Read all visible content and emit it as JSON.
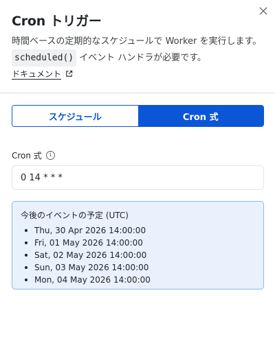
{
  "panel": {
    "title": "Cron トリガー",
    "description_line1": "時間ベースの定期的なスケジュールで Worker を実行します。",
    "code_snippet": "scheduled()",
    "description_line2_suffix": "イベント ハンドラが必要です。",
    "doc_link_label": "ドキュメント",
    "close_icon": "close-icon",
    "external_link_icon": "external-link-icon"
  },
  "mode_toggle": {
    "options": [
      "スケジュール",
      "Cron 式"
    ],
    "selected": "Cron 式",
    "accent_color": "#0a56d6"
  },
  "cron_field": {
    "label": "Cron 式",
    "info_icon": "info-icon",
    "value": "0 14 * * *"
  },
  "upcoming": {
    "title": "今後のイベントの予定 (UTC)",
    "events": [
      "Thu, 30 Apr 2026 14:00:00",
      "Fri, 01 May 2026 14:00:00",
      "Sat, 02 May 2026 14:00:00",
      "Sun, 03 May 2026 14:00:00",
      "Mon, 04 May 2026 14:00:00"
    ],
    "background_color": "#e8f1fc",
    "border_color": "#8fb8e8"
  }
}
